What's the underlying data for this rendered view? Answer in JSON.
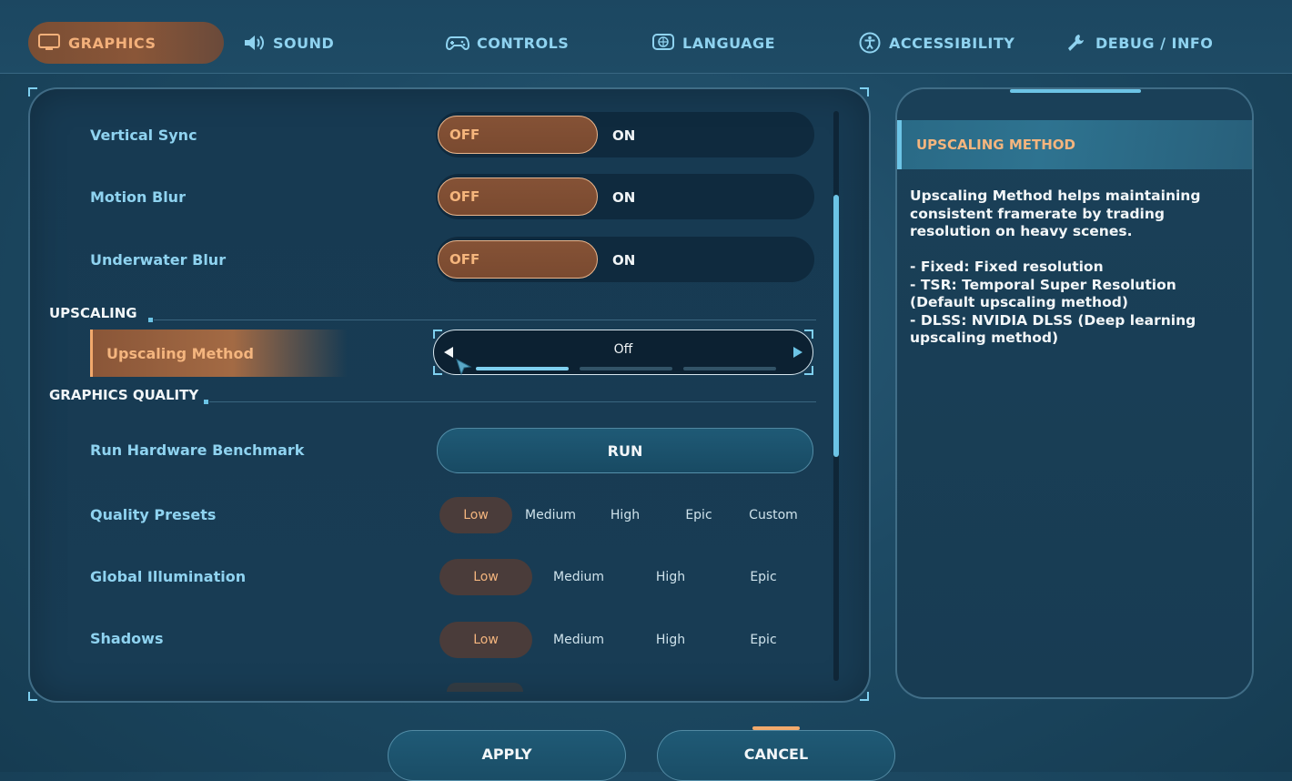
{
  "tabs": [
    {
      "label": "GRAPHICS",
      "icon": "monitor-icon",
      "active": true
    },
    {
      "label": "SOUND",
      "icon": "speaker-icon",
      "active": false
    },
    {
      "label": "CONTROLS",
      "icon": "gamepad-icon",
      "active": false
    },
    {
      "label": "LANGUAGE",
      "icon": "globe-icon",
      "active": false
    },
    {
      "label": "ACCESSIBILITY",
      "icon": "accessibility-icon",
      "active": false
    },
    {
      "label": "DEBUG / INFO",
      "icon": "wrench-icon",
      "active": false
    }
  ],
  "toggles": [
    {
      "label": "Vertical Sync",
      "off": "OFF",
      "on": "ON",
      "value": "OFF"
    },
    {
      "label": "Motion Blur",
      "off": "OFF",
      "on": "ON",
      "value": "OFF"
    },
    {
      "label": "Underwater Blur",
      "off": "OFF",
      "on": "ON",
      "value": "OFF"
    }
  ],
  "sections": {
    "upscaling": "UPSCALING",
    "quality": "GRAPHICS QUALITY"
  },
  "upscaling_method": {
    "label": "Upscaling Method",
    "value": "Off",
    "option_count": 3,
    "selected_index": 0
  },
  "benchmark": {
    "label": "Run Hardware Benchmark",
    "button": "RUN"
  },
  "quality_presets": {
    "label": "Quality Presets",
    "options": [
      "Low",
      "Medium",
      "High",
      "Epic",
      "Custom"
    ],
    "selected": "Low"
  },
  "global_illumination": {
    "label": "Global Illumination",
    "options": [
      "Low",
      "Medium",
      "High",
      "Epic"
    ],
    "selected": "Low"
  },
  "shadows": {
    "label": "Shadows",
    "options": [
      "Low",
      "Medium",
      "High",
      "Epic"
    ],
    "selected": "Low"
  },
  "info": {
    "title": "UPSCALING METHOD",
    "description": "Upscaling Method helps maintaining consistent framerate by trading resolution on heavy scenes.",
    "items": [
      "- Fixed: Fixed resolution",
      "- TSR: Temporal Super Resolution (Default upscaling method)",
      "- DLSS: NVIDIA DLSS (Deep learning upscaling method)"
    ]
  },
  "actions": {
    "apply": "APPLY",
    "cancel": "CANCEL"
  },
  "colors": {
    "accent_orange": "#f4b57e",
    "accent_cyan": "#6cc4e6",
    "label_blue": "#8fd3f0"
  }
}
